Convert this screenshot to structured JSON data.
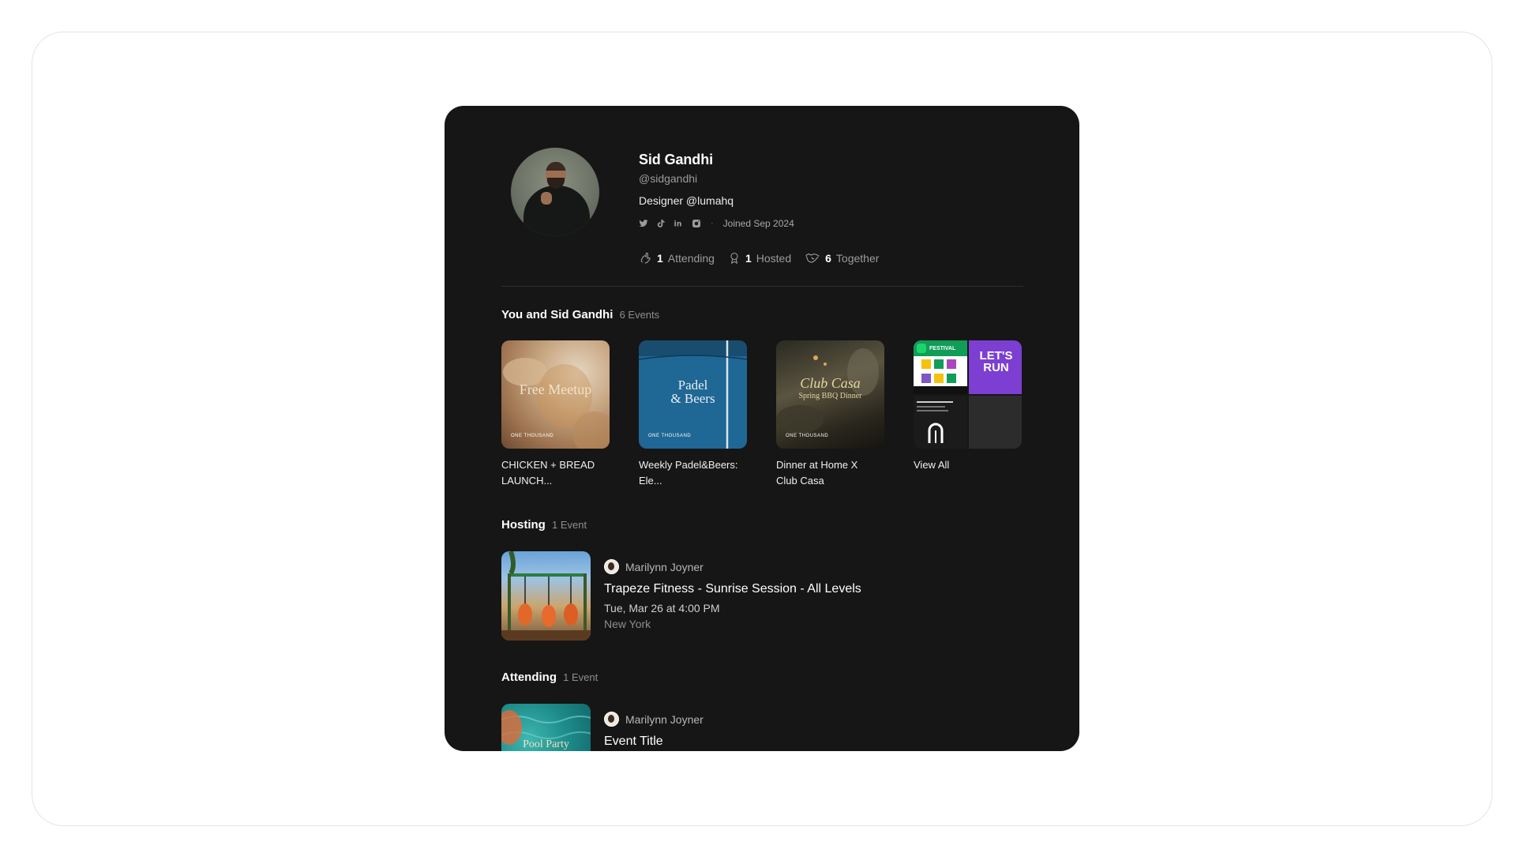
{
  "profile": {
    "name": "Sid Gandhi",
    "handle": "@sidgandhi",
    "bio": "Designer @lumahq",
    "social_icons": [
      "twitter-icon",
      "tiktok-icon",
      "linkedin-icon",
      "instagram-icon"
    ],
    "separator": "·",
    "joined": "Joined Sep 2024",
    "stats": {
      "attending_count": "1",
      "attending_label": "Attending",
      "hosted_count": "1",
      "hosted_label": "Hosted",
      "together_count": "6",
      "together_label": "Together"
    }
  },
  "shared": {
    "title": "You and Sid Gandhi",
    "count": "6 Events",
    "events": [
      {
        "label": "CHICKEN + BREAD LAUNCH...",
        "art_text": "Free Meetup",
        "brand": "ONE THOUSAND"
      },
      {
        "label": "Weekly Padel&Beers: Ele...",
        "art_text_1": "Padel",
        "art_text_2": "& Beers",
        "brand": "ONE THOUSAND"
      },
      {
        "label": "Dinner at Home X Club Casa",
        "art_text_1": "Club Casa",
        "art_text_2": "Spring BBQ Dinner",
        "brand": "ONE THOUSAND"
      }
    ],
    "view_all": {
      "label": "View All",
      "art_text_festival": "FESTIVAL",
      "art_text_run": "LET'S RUN"
    }
  },
  "hosting": {
    "title": "Hosting",
    "count": "1 Event",
    "event": {
      "host": "Marilynn Joyner",
      "title": "Trapeze Fitness - Sunrise Session - All Levels",
      "date": "Tue, Mar 26 at 4:00 PM",
      "location": "New York"
    }
  },
  "attending": {
    "title": "Attending",
    "count": "1 Event",
    "event": {
      "host": "Marilynn Joyner",
      "title": "Event Title",
      "art_text": "Pool Party"
    }
  },
  "colors": {
    "card_bg": "#161616",
    "text_primary": "#ffffff",
    "text_secondary": "#9b9b9b",
    "divider": "#2e2e2e"
  }
}
